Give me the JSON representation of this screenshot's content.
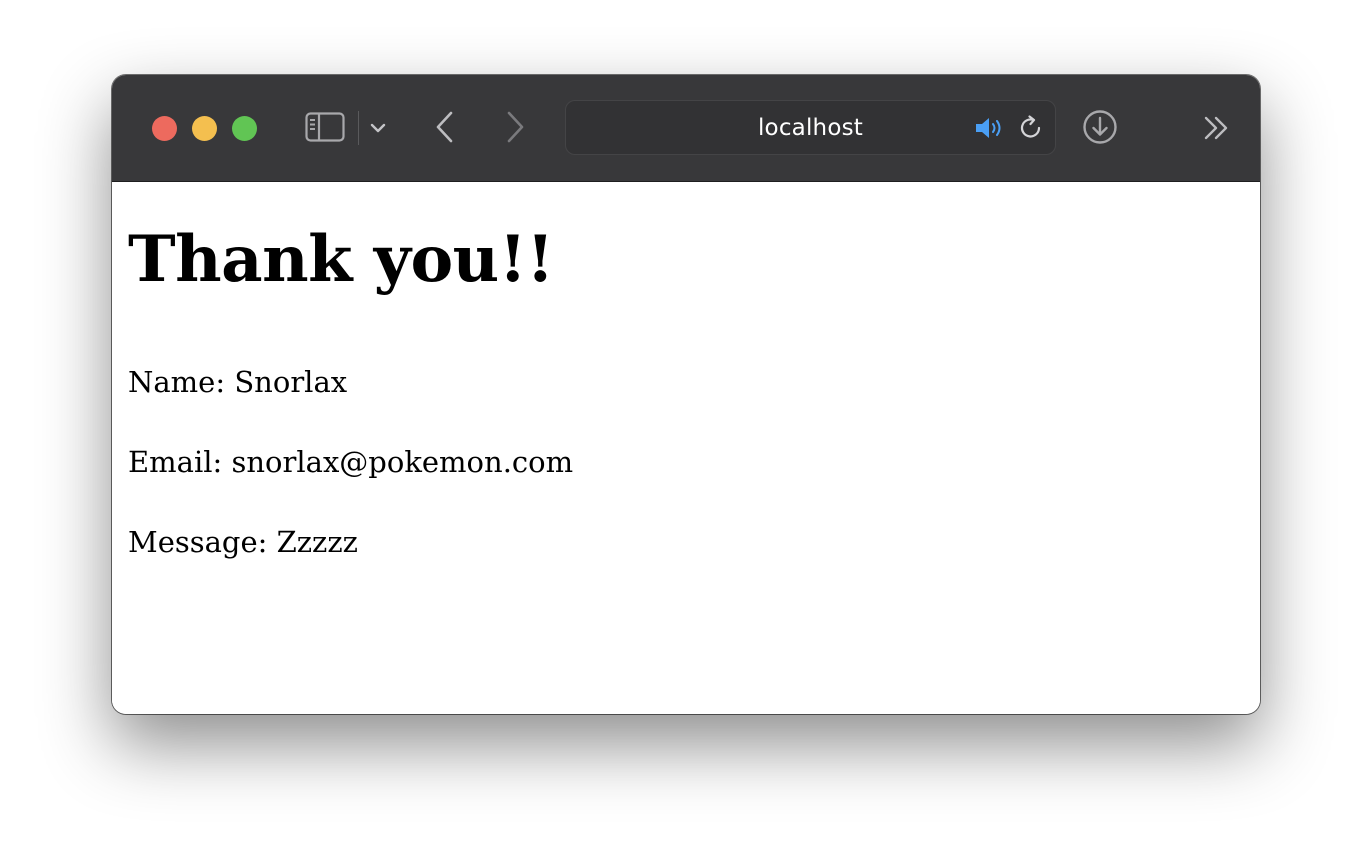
{
  "window": {
    "controls": {
      "close_color": "#ed6a5e",
      "minimize_color": "#f4bf4f",
      "maximize_color": "#61c554"
    },
    "toolbar_color": "#38383a"
  },
  "toolbar": {
    "icons": [
      "sidebar-icon",
      "chevron-down-icon",
      "back-arrow-icon",
      "forward-arrow-icon",
      "speaker-icon",
      "reload-icon",
      "download-icon",
      "double-chevron-right-icon"
    ],
    "address": "localhost",
    "speaker_color": "#4a9ff5"
  },
  "page": {
    "heading": "Thank you!!",
    "name_line": "Name: Snorlax",
    "email_line": "Email: snorlax@pokemon.com",
    "message_line": "Message: Zzzzz"
  }
}
